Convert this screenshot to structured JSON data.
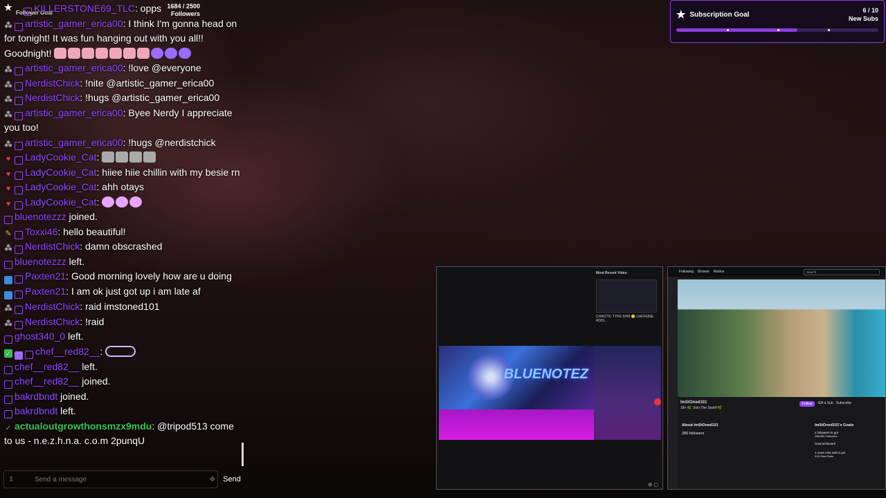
{
  "follower_goal": {
    "label": "Follower Goal",
    "count": "1684 / 2500",
    "unit": "Followers"
  },
  "subscription_goal": {
    "title": "Subscription Goal",
    "count": "6 / 10",
    "unit": "New Subs",
    "progress": 0.6
  },
  "chat": {
    "messages": [
      {
        "user": "KILLERSTONE69_TLC",
        "text": ": opps",
        "color": "#9147ff"
      },
      {
        "user": "artistic_gamer_erica00",
        "text": ": I think I'm gonna head on for tonight! It was fun hanging out with you all!! Goodnight!",
        "color": "#9147ff"
      },
      {
        "user": "artistic_gamer_erica00",
        "text": ": !love @everyone",
        "color": "#9147ff"
      },
      {
        "user": "NerdistChick",
        "text": ": !nite @artistic_gamer_erica00",
        "color": "#9147ff"
      },
      {
        "user": "NerdistChick",
        "text": ": !hugs @artistic_gamer_erica00",
        "color": "#9147ff"
      },
      {
        "user": "artistic_gamer_erica00",
        "text": ": Byee Nerdy I appreciate you too!",
        "color": "#9147ff"
      },
      {
        "user": "artistic_gamer_erica00",
        "text": ": !hugs @nerdistchick",
        "color": "#9147ff"
      },
      {
        "user": "LadyCookie_Cat",
        "text": ":",
        "color": "#9147ff"
      },
      {
        "user": "LadyCookie_Cat",
        "text": ": hiiee hiie chillin with my besie rn",
        "color": "#9147ff"
      },
      {
        "user": "LadyCookie_Cat",
        "text": ": ahh otays",
        "color": "#9147ff"
      },
      {
        "user": "LadyCookie_Cat",
        "text": ":",
        "color": "#9147ff"
      },
      {
        "user": "bluenotezzz",
        "text": " joined.",
        "color": "#9147ff"
      },
      {
        "user": "Toxxi46",
        "text": ": hello beautiful!",
        "color": "#9147ff"
      },
      {
        "user": "NerdistChick",
        "text": ": damn obscrashed",
        "color": "#9147ff"
      },
      {
        "user": "bluenotezzz",
        "text": " left.",
        "color": "#9147ff"
      },
      {
        "user": "Paxten21",
        "text": ": Good morning lovely how are u doing",
        "color": "#9147ff"
      },
      {
        "user": "Paxten21",
        "text": ": I am ok just got up i am late af",
        "color": "#9147ff"
      },
      {
        "user": "NerdistChick",
        "text": ": raid imstoned101",
        "color": "#9147ff"
      },
      {
        "user": "NerdistChick",
        "text": ": !raid",
        "color": "#9147ff"
      },
      {
        "user": "ghost340_0",
        "text": " left.",
        "color": "#9147ff"
      },
      {
        "user": "chef__red82__",
        "text": ":",
        "color": "#9147ff"
      },
      {
        "user": "chef__red82__",
        "text": " left.",
        "color": "#9147ff"
      },
      {
        "user": "chef__red82__",
        "text": " joined.",
        "color": "#9147ff"
      },
      {
        "user": "bakrdbndt",
        "text": " joined.",
        "color": "#9147ff"
      },
      {
        "user": "bakrdbndt",
        "text": " left.",
        "color": "#9147ff"
      },
      {
        "user": "actualoutgrowthonsmzx9mdu",
        "text": ": @tripod513 come to us - n.e.z.h.n.a. c.o.m 2punqU",
        "color": "#39c25a"
      }
    ],
    "input_placeholder": "Send a message",
    "send_label": "Send"
  },
  "mini_window_1": {
    "recent_label": "Most Recent Video",
    "recent_caption": "CHAOTIC TYPE SHIII 🙂 CAFFEINE ADDI...",
    "banner_text": "BLUENOTEZ"
  },
  "mini_window_2": {
    "nav": [
      "Following",
      "Browse",
      "Roblox"
    ],
    "search_placeholder": "Search",
    "channel": "ImStOned101",
    "stream_title": "18+ 🌿 !Join The Sesh!!🌿",
    "follow_label": "Follow",
    "gift_label": "Gift a Sub",
    "subscribe_label": "Subscribe",
    "about_label": "About ImStOned101",
    "followers": "286 followers",
    "goals_label": "ImStOned101's Goals",
    "goal1": "4 followers to go!",
    "goal1_sub": "286/300 Followers",
    "goal2": "Goal achieved!",
    "goal3": "1 more new sub to go!",
    "goal3_sub": "9/10 New Subs"
  }
}
